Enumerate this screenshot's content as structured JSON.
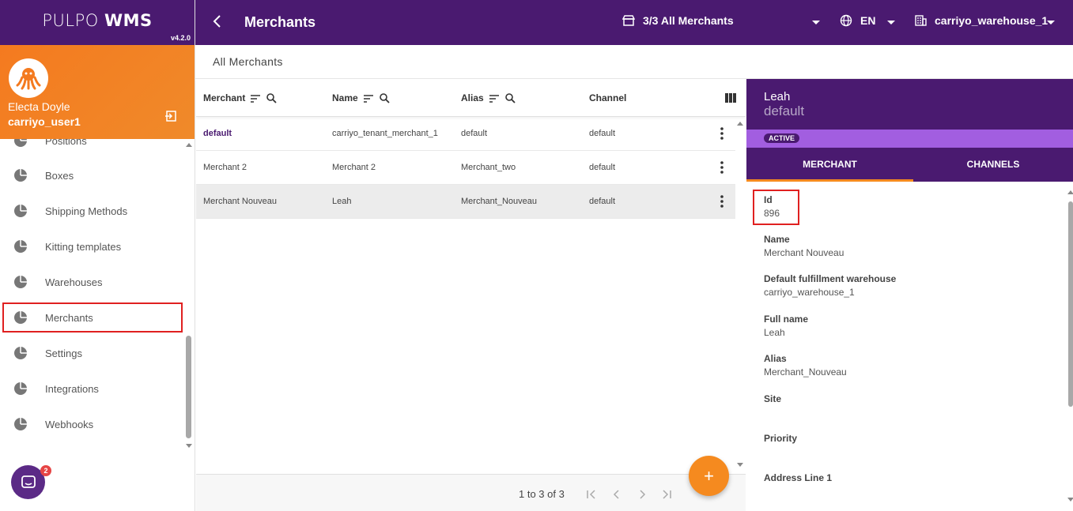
{
  "brand": {
    "name_light": "PULPO",
    "name_bold": "WMS",
    "version": "v4.2.0"
  },
  "user": {
    "name": "Electa Doyle",
    "login": "carriyo_user1"
  },
  "sidebar": {
    "items": [
      {
        "label": "Positions",
        "icon": "pie-icon"
      },
      {
        "label": "Boxes",
        "icon": "pie-icon"
      },
      {
        "label": "Shipping Methods",
        "icon": "pie-icon"
      },
      {
        "label": "Kitting templates",
        "icon": "pie-icon"
      },
      {
        "label": "Warehouses",
        "icon": "pie-icon"
      },
      {
        "label": "Merchants",
        "icon": "pie-icon"
      },
      {
        "label": "Settings",
        "icon": "pie-icon"
      },
      {
        "label": "Integrations",
        "icon": "pie-icon"
      },
      {
        "label": "Webhooks",
        "icon": "pie-icon"
      }
    ],
    "chat_badge": "2"
  },
  "topbar": {
    "title": "Merchants",
    "merchant_selector": "3/3 All Merchants",
    "language": "EN",
    "warehouse": "carriyo_warehouse_1"
  },
  "subheader": {
    "title": "All Merchants"
  },
  "table": {
    "columns": [
      "Merchant",
      "Name",
      "Alias",
      "Channel"
    ],
    "rows": [
      {
        "merchant": "default",
        "name": "carriyo_tenant_merchant_1",
        "alias": "default",
        "channel": "default"
      },
      {
        "merchant": "Merchant 2",
        "name": "Merchant 2",
        "alias": "Merchant_two",
        "channel": "default"
      },
      {
        "merchant": "Merchant Nouveau",
        "name": "Leah",
        "alias": "Merchant_Nouveau",
        "channel": "default"
      }
    ],
    "pagination": "1 to 3 of 3",
    "fab_label": "+"
  },
  "detail": {
    "name": "Leah",
    "subtitle": "default",
    "status": "ACTIVE",
    "tabs": [
      "MERCHANT",
      "CHANNELS"
    ],
    "fields": [
      {
        "label": "Id",
        "value": "896"
      },
      {
        "label": "Name",
        "value": "Merchant Nouveau"
      },
      {
        "label": "Default fulfillment warehouse",
        "value": "carriyo_warehouse_1"
      },
      {
        "label": "Full name",
        "value": "Leah"
      },
      {
        "label": "Alias",
        "value": "Merchant_Nouveau"
      },
      {
        "label": "Site",
        "value": ""
      },
      {
        "label": "Priority",
        "value": ""
      },
      {
        "label": "Address Line 1",
        "value": ""
      }
    ]
  },
  "colors": {
    "primary": "#4a1a70",
    "accent": "#f58a1f",
    "status": "#a25ee0",
    "highlight": "#e02020"
  }
}
